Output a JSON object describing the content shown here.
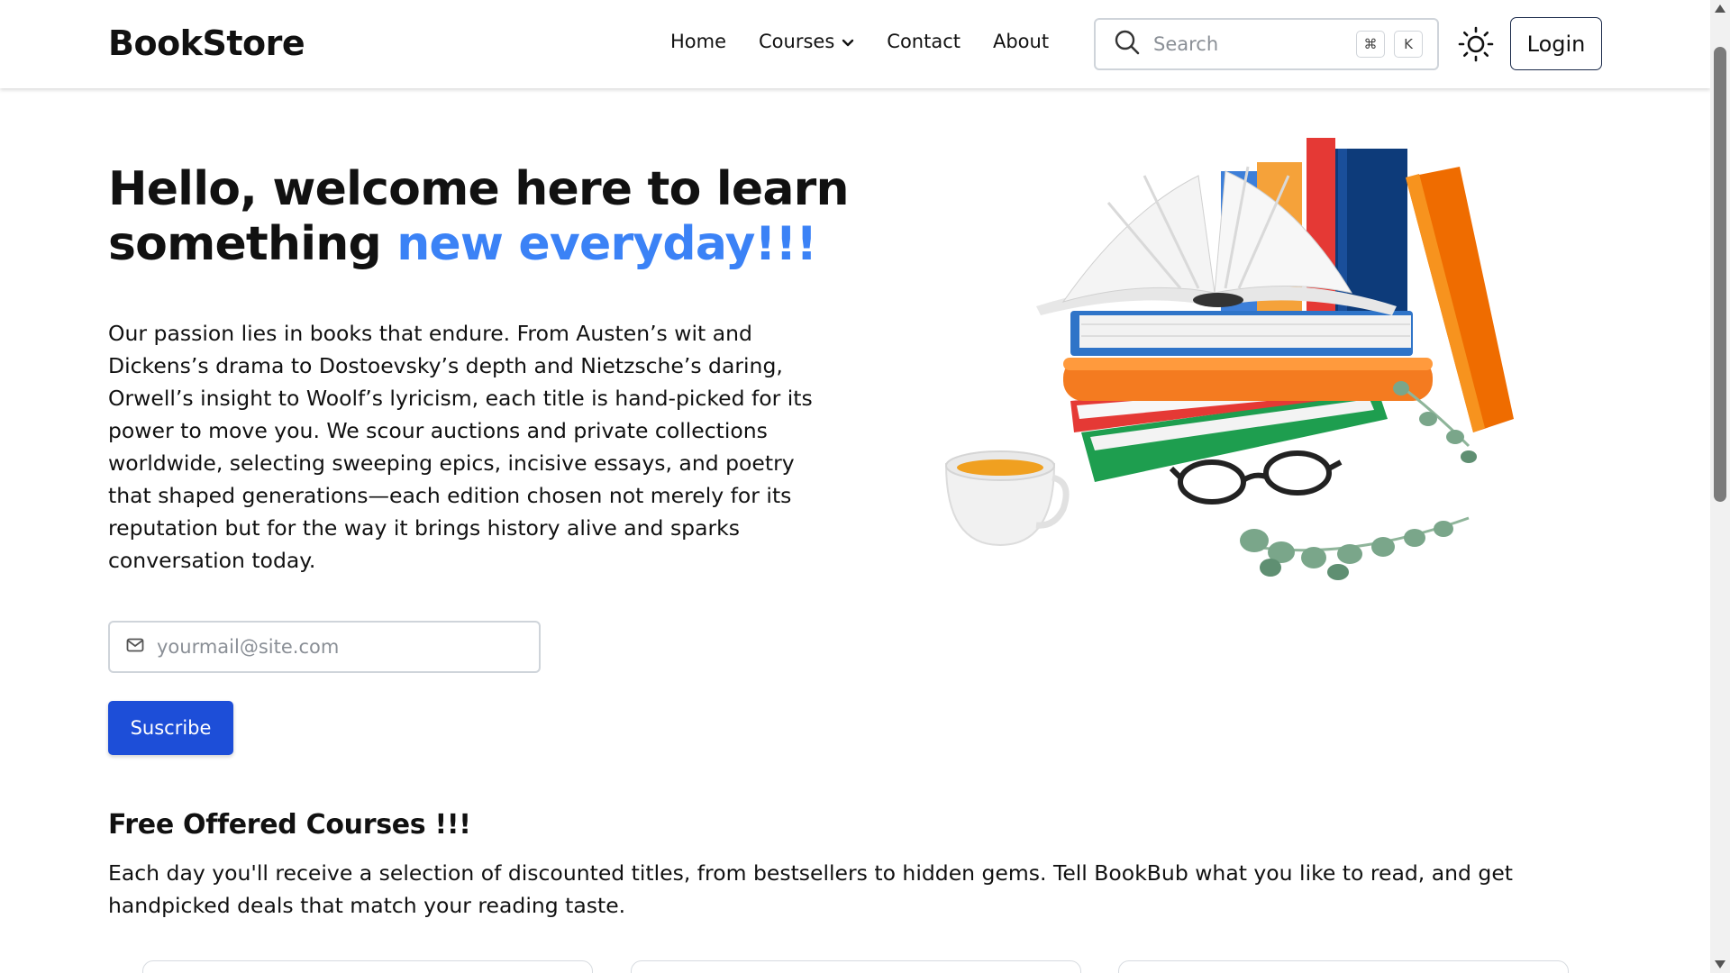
{
  "header": {
    "brand": "BookStore",
    "nav": {
      "home": "Home",
      "courses": "Courses",
      "contact": "Contact",
      "about": "About"
    },
    "search": {
      "placeholder": "Search",
      "shortcut_key_1": "⌘",
      "shortcut_key_2": "K"
    },
    "login_label": "Login"
  },
  "hero": {
    "title_part1": "Hello, welcome here to learn something ",
    "title_accent": "new everyday!!!",
    "paragraph": "Our passion lies in books that endure. From Austen’s wit and Dickens’s drama to Dostoevsky’s depth and Nietzsche’s daring, Orwell’s insight to Woolf’s lyricism, each title is hand-picked for its power to move you. We scour auctions and private collections worldwide, selecting sweeping epics, incisive essays, and poetry that shaped generations—each edition chosen not merely for its reputation but for the way it brings history alive and sparks conversation today.",
    "email_placeholder": "yourmail@site.com",
    "subscribe_label": "Suscribe"
  },
  "courses_section": {
    "title": "Free Offered Courses !!!",
    "description": "Each day you'll receive a selection of discounted titles, from bestsellers to hidden gems. Tell BookBub what you like to read, and get handpicked deals that match your reading taste."
  },
  "colors": {
    "accent_blue": "#3b82f6",
    "button_blue": "#1d4ed8"
  }
}
